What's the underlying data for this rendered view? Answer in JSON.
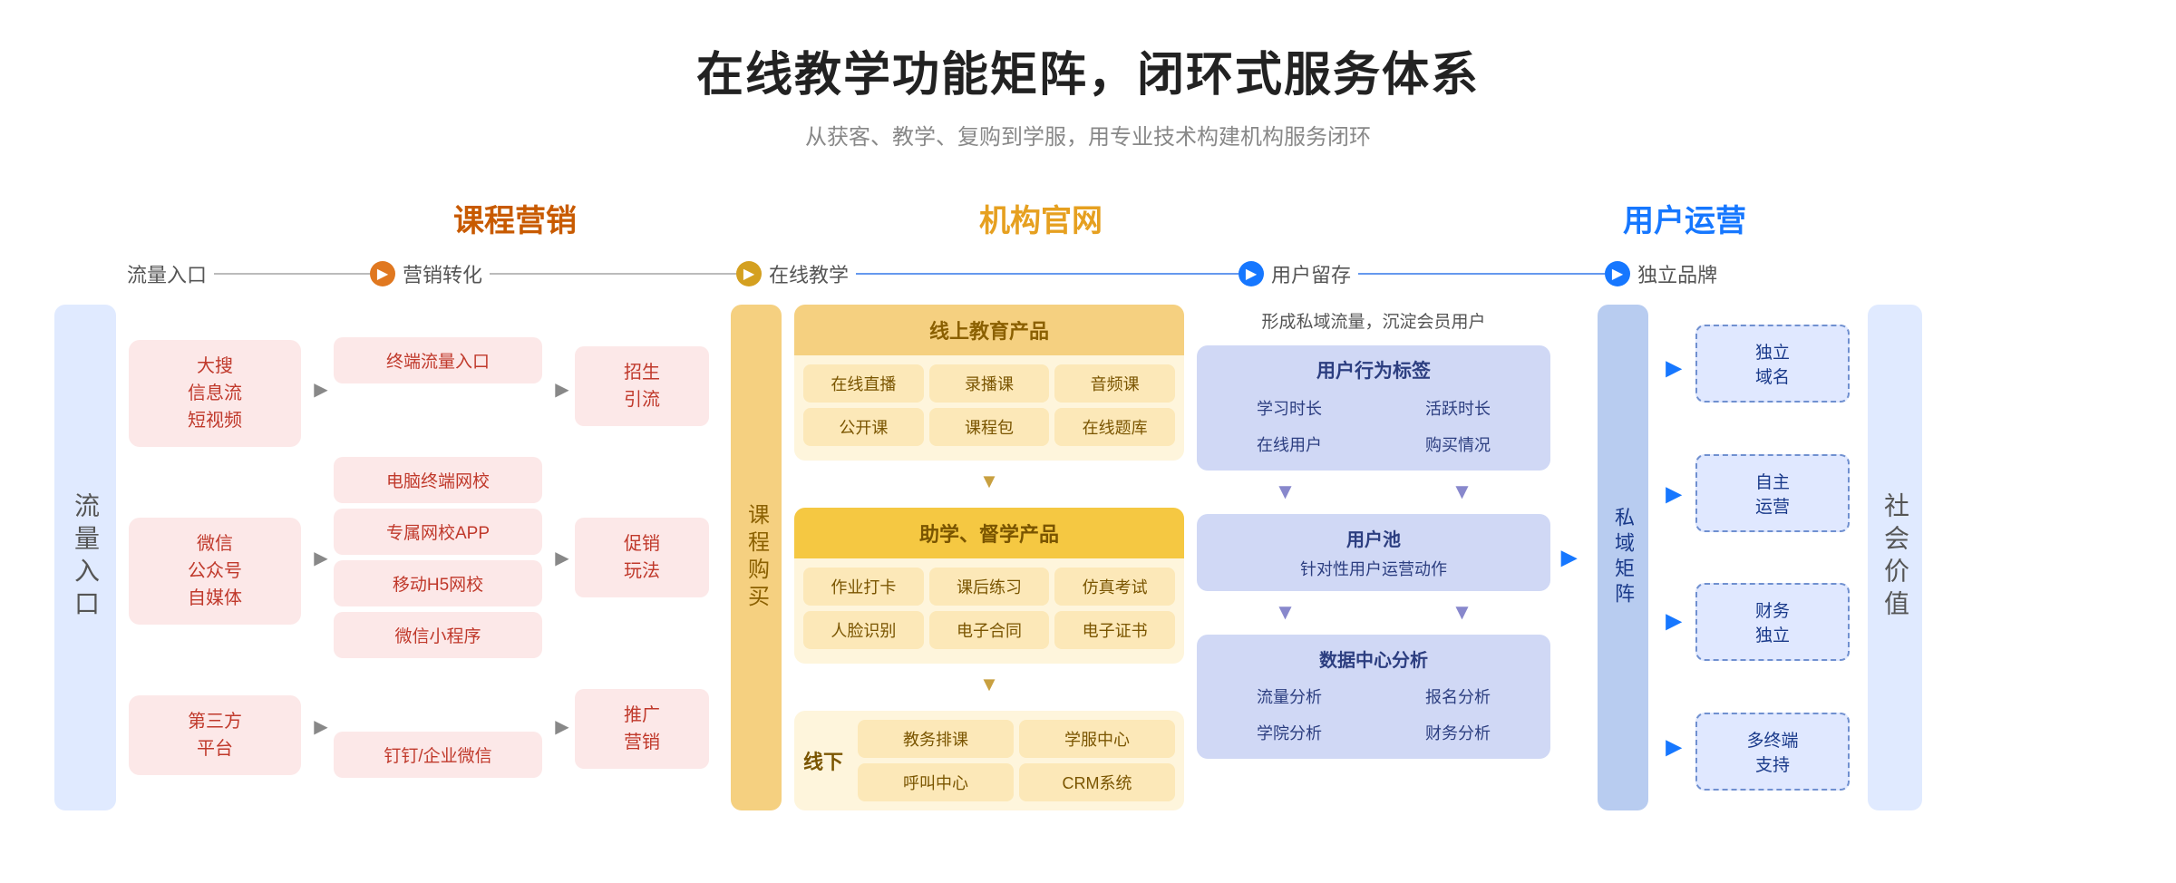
{
  "title": "在线教学功能矩阵，闭环式服务体系",
  "subtitle": "从获客、教学、复购到学服，用专业技术构建机构服务闭环",
  "categories": {
    "marketing": "课程营销",
    "website": "机构官网",
    "operations": "用户运营"
  },
  "stages": {
    "traffic_entry": "流量入口",
    "marketing_conversion": "营销转化",
    "online_teaching": "在线教学",
    "user_retention": "用户留存",
    "independent_brand": "独立品牌"
  },
  "left_label": "流量入口",
  "right_label": "社会价值",
  "traffic_sources": [
    {
      "text": "大搜\n信息流\n短视频"
    },
    {
      "text": "微信\n公众号\n自媒体"
    },
    {
      "text": "第三方\n平台"
    }
  ],
  "marketing_platforms": [
    "终端流量入口",
    "电脑终端网校",
    "专属网校APP",
    "移动H5网校",
    "微信小程序",
    "钉钉/企业微信"
  ],
  "conversion": [
    {
      "text": "招生\n引流"
    },
    {
      "text": "促销\n玩法"
    },
    {
      "text": "推广\n营销"
    }
  ],
  "course_buy_label": "课程购买",
  "online_products": {
    "header": "线上教育产品",
    "items": [
      "在线直播",
      "录播课",
      "音频课",
      "公开课",
      "课程包",
      "在线题库"
    ]
  },
  "assist_products": {
    "header": "助学、督学产品",
    "items": [
      "作业打卡",
      "课后练习",
      "仿真考试",
      "人脸识别",
      "电子合同",
      "电子证书"
    ]
  },
  "offline": {
    "label": "线下",
    "items": [
      "教务排课",
      "学服中心",
      "呼叫中心",
      "CRM系统"
    ]
  },
  "retention_top_text": "形成私域流量，沉淀会员用户",
  "user_behavior_tags": {
    "title": "用户行为标签",
    "items": [
      "学习时长",
      "活跃时长",
      "在线用户",
      "购买情况"
    ]
  },
  "user_pool": {
    "title": "用户池",
    "subtitle": "针对性用户运营动作"
  },
  "data_center": {
    "title": "数据中心分析",
    "items": [
      "流量分析",
      "报名分析",
      "学院分析",
      "财务分析"
    ]
  },
  "private_domain_label": "私域矩阵",
  "independent_brand_items": [
    "独立\n域名",
    "自主\n运营",
    "财务\n独立",
    "多终端\n支持"
  ]
}
